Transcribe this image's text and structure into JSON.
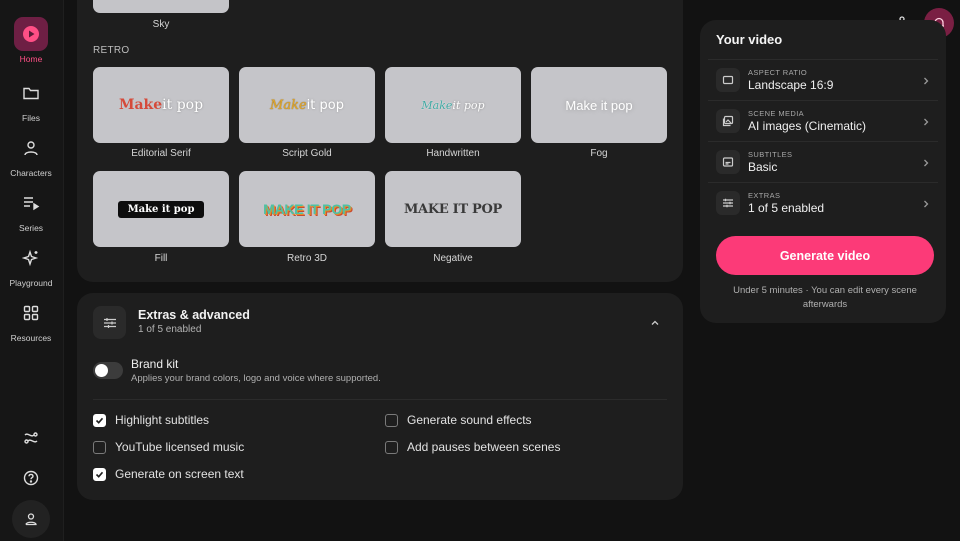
{
  "sidebar": {
    "items": [
      {
        "label": "Home",
        "icon": "play-icon",
        "active": true
      },
      {
        "label": "Files",
        "icon": "folder-icon"
      },
      {
        "label": "Characters",
        "icon": "user-icon"
      },
      {
        "label": "Series",
        "icon": "series-icon"
      },
      {
        "label": "Playground",
        "icon": "sparkle-icon"
      },
      {
        "label": "Resources",
        "icon": "grid-icon"
      }
    ],
    "bottom": [
      "integrations-icon",
      "help-icon",
      "account-icon"
    ]
  },
  "styles": {
    "sky_label": "Sky",
    "retro_section": "RETRO",
    "items": [
      {
        "label": "Editorial Serif",
        "preview_a": "Make",
        "preview_b": " it pop"
      },
      {
        "label": "Script Gold",
        "preview_a": "Make",
        "preview_b": " it pop"
      },
      {
        "label": "Handwritten",
        "preview_a": "Make",
        "preview_b": " it pop"
      },
      {
        "label": "Fog",
        "preview": "Make it pop"
      },
      {
        "label": "Fill",
        "preview": "Make it pop"
      },
      {
        "label": "Retro 3D",
        "preview": "MAKE IT POP"
      },
      {
        "label": "Negative",
        "preview": "MAKE IT POP"
      }
    ]
  },
  "extras": {
    "title": "Extras & advanced",
    "subtitle": "1 of 5 enabled",
    "brand_kit": {
      "title": "Brand kit",
      "description": "Applies your brand colors, logo and voice where supported.",
      "enabled": false
    },
    "options": [
      {
        "label": "Highlight subtitles",
        "checked": true
      },
      {
        "label": "Generate sound effects",
        "checked": false
      },
      {
        "label": "YouTube licensed music",
        "checked": false
      },
      {
        "label": "Add pauses between scenes",
        "checked": false
      },
      {
        "label": "Generate on screen text",
        "checked": true
      }
    ]
  },
  "your_video": {
    "title": "Your video",
    "settings": [
      {
        "caption": "ASPECT RATIO",
        "value": "Landscape 16:9",
        "icon": "aspect-ratio-icon"
      },
      {
        "caption": "SCENE MEDIA",
        "value": "AI images (Cinematic)",
        "icon": "media-icon"
      },
      {
        "caption": "SUBTITLES",
        "value": "Basic",
        "icon": "subtitles-icon"
      },
      {
        "caption": "EXTRAS",
        "value": "1 of 5 enabled",
        "icon": "sliders-icon"
      }
    ],
    "generate_label": "Generate video",
    "note": "Under 5 minutes · You can edit every scene afterwards"
  },
  "colors": {
    "accent": "#fc3a78",
    "active_nav_bg": "#6e1f44",
    "bell_bg": "#7a1f43"
  }
}
